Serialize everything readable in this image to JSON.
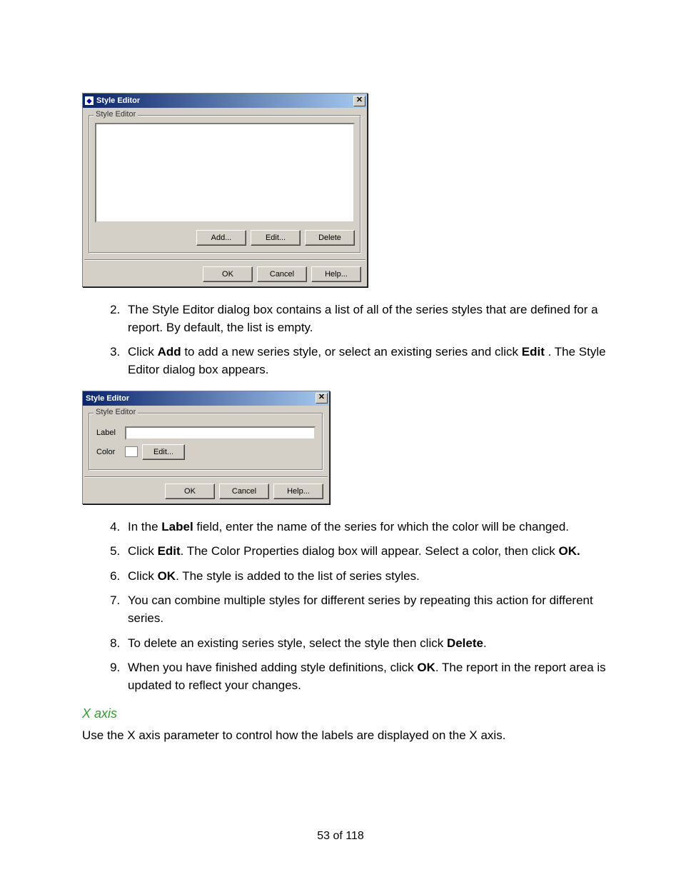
{
  "dialog1": {
    "title": "Style Editor",
    "group_legend": "Style Editor",
    "buttons": {
      "add": "Add...",
      "edit": "Edit...",
      "delete": "Delete",
      "ok": "OK",
      "cancel": "Cancel",
      "help": "Help..."
    }
  },
  "dialog2": {
    "title": "Style Editor",
    "group_legend": "Style Editor",
    "labels": {
      "label": "Label",
      "color": "Color"
    },
    "buttons": {
      "edit": "Edit...",
      "ok": "OK",
      "cancel": "Cancel",
      "help": "Help..."
    }
  },
  "steps_a": {
    "s2_pre": "The Style Editor dialog box contains a list of all of the series styles that are defined for a report. By default, the list is empty.",
    "s3_a": "Click ",
    "s3_b": "Add",
    "s3_c": " to add a new series style, or select an existing series and click ",
    "s3_d": "Edit",
    "s3_e": " . The Style Editor dialog box appears."
  },
  "steps_b": {
    "s4_a": "In the ",
    "s4_b": "Label",
    "s4_c": " field, enter the name of the series for which the color will be changed.",
    "s5_a": "Click ",
    "s5_b": "Edit",
    "s5_c": ". The Color Properties dialog box will appear. Select a color, then click ",
    "s5_d": "OK.",
    "s6_a": "Click ",
    "s6_b": "OK",
    "s6_c": ". The style is added to the list of series styles.",
    "s7": "You can combine multiple styles for different series by repeating this action for different series.",
    "s8_a": "To delete an existing series style, select the style then click ",
    "s8_b": "Delete",
    "s8_c": ".",
    "s9_a": "When you have finished adding style definitions, click ",
    "s9_b": "OK",
    "s9_c": ". The report in the report area is updated to reflect your changes."
  },
  "heading": "X axis",
  "body": "Use the X axis parameter to control how the labels are displayed on the X axis.",
  "pager": "53 of 118"
}
